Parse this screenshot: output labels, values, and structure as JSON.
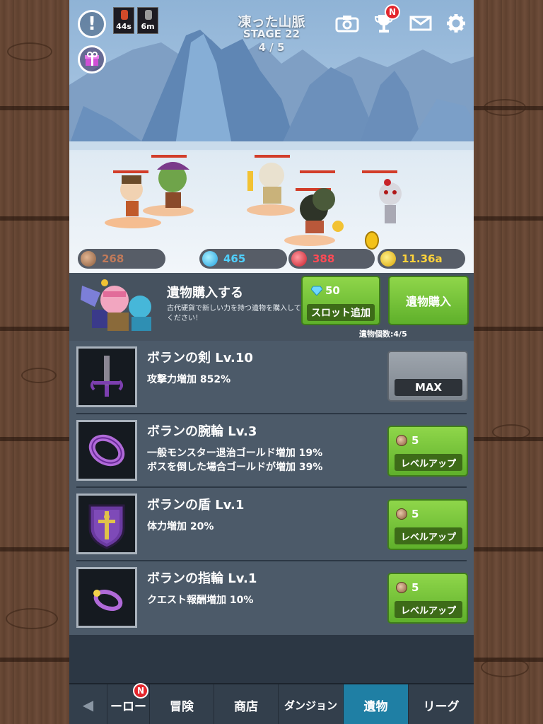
{
  "stage": {
    "area_name": "凍った山脈",
    "stage_label": "STAGE 22",
    "progress": "4 / 5"
  },
  "top_left": {
    "buff1_timer": "44s",
    "buff2_timer": "6m"
  },
  "top_right": {
    "notification_badge": "N"
  },
  "currencies": [
    {
      "name": "relic-coins",
      "value": "268",
      "color": "#c07a5a"
    },
    {
      "name": "gems",
      "value": "465",
      "color": "#4fd0ff"
    },
    {
      "name": "red-gems",
      "value": "388",
      "color": "#ff4a55"
    },
    {
      "name": "gold",
      "value": "11.36a",
      "color": "#ffd23a"
    }
  ],
  "purchase": {
    "title": "遺物購入する",
    "description": "古代硬貨で新しい力を持つ遺物を購入してください！",
    "slot_cost": "50",
    "slot_label": "スロット追加",
    "buy_label": "遺物購入",
    "relic_count": "遺物個数:4/5"
  },
  "relics": [
    {
      "name": "ボランの剣 Lv.10",
      "effects": [
        "攻撃力増加 852%"
      ],
      "icon": "sword-icon",
      "button": "MAX",
      "cost": ""
    },
    {
      "name": "ボランの腕輪 Lv.3",
      "effects": [
        "一般モンスター退治ゴールド増加 19%",
        "ボスを倒した場合ゴールドが増加 39%"
      ],
      "icon": "bracelet-icon",
      "button": "レベルアップ",
      "cost": "5"
    },
    {
      "name": "ボランの盾 Lv.1",
      "effects": [
        "体力増加 20%"
      ],
      "icon": "shield-icon",
      "button": "レベルアップ",
      "cost": "5"
    },
    {
      "name": "ボランの指輪 Lv.1",
      "effects": [
        "クエスト報酬増加 10%"
      ],
      "icon": "ring-icon",
      "button": "レベルアップ",
      "cost": "5"
    }
  ],
  "tabs": {
    "prev_arrow": "◀",
    "items": [
      "ーロー",
      "冒険",
      "商店",
      "ダンジョン",
      "遺物",
      "リーグ"
    ],
    "active": "遺物",
    "badge": "N"
  },
  "colors": {
    "accent_green": "#6cc232",
    "active_tab": "#1f7fa4",
    "panel": "#4c5a69"
  }
}
